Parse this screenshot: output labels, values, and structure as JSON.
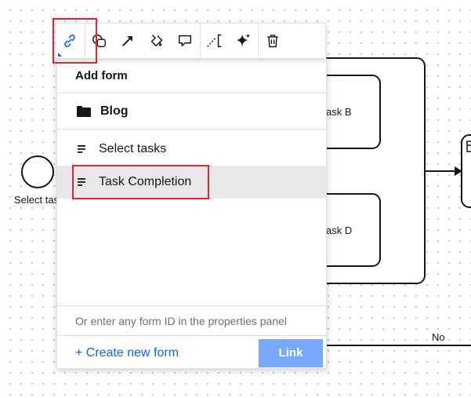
{
  "diagram": {
    "start_event_label": "Select tas",
    "task_b_label": "ask B",
    "task_d_label": "ask D",
    "flow_label_no": "No"
  },
  "toolbar": {
    "tools": [
      {
        "name": "link-icon",
        "active": true
      },
      {
        "name": "shapes-icon"
      },
      {
        "name": "arrow-icon"
      },
      {
        "name": "paint-icon"
      },
      {
        "name": "comment-icon"
      },
      {
        "name": "annotation-icon"
      },
      {
        "name": "sparkle-icon"
      },
      {
        "name": "trash-icon"
      }
    ]
  },
  "popup": {
    "title": "Add form",
    "folder": {
      "label": "Blog",
      "icon": "folder-icon"
    },
    "forms": [
      {
        "label": "Select tasks",
        "icon": "form-icon",
        "selected": false
      },
      {
        "label": "Task Completion",
        "icon": "form-icon",
        "selected": true
      }
    ],
    "hint": "Or enter any form ID in the properties panel",
    "create_label": "+ Create new form",
    "link_label": "Link"
  },
  "colors": {
    "accent": "#0f62fe",
    "link_button": "#78a9ff",
    "highlight": "#e0262a",
    "selected_row": "#e8e8e8"
  }
}
